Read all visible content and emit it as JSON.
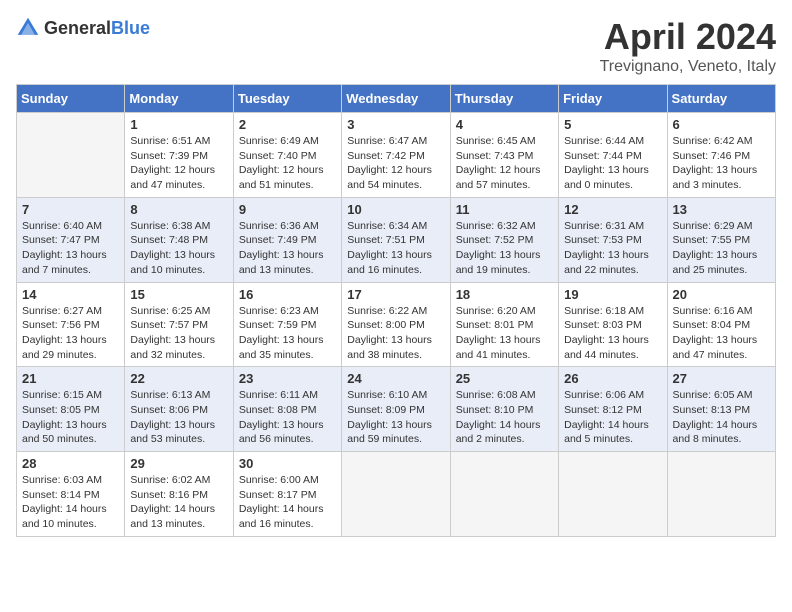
{
  "header": {
    "logo_general": "General",
    "logo_blue": "Blue",
    "title": "April 2024",
    "location": "Trevignano, Veneto, Italy"
  },
  "days_of_week": [
    "Sunday",
    "Monday",
    "Tuesday",
    "Wednesday",
    "Thursday",
    "Friday",
    "Saturday"
  ],
  "weeks": [
    [
      {
        "day": "",
        "sunrise": "",
        "sunset": "",
        "daylight": ""
      },
      {
        "day": "1",
        "sunrise": "Sunrise: 6:51 AM",
        "sunset": "Sunset: 7:39 PM",
        "daylight": "Daylight: 12 hours and 47 minutes."
      },
      {
        "day": "2",
        "sunrise": "Sunrise: 6:49 AM",
        "sunset": "Sunset: 7:40 PM",
        "daylight": "Daylight: 12 hours and 51 minutes."
      },
      {
        "day": "3",
        "sunrise": "Sunrise: 6:47 AM",
        "sunset": "Sunset: 7:42 PM",
        "daylight": "Daylight: 12 hours and 54 minutes."
      },
      {
        "day": "4",
        "sunrise": "Sunrise: 6:45 AM",
        "sunset": "Sunset: 7:43 PM",
        "daylight": "Daylight: 12 hours and 57 minutes."
      },
      {
        "day": "5",
        "sunrise": "Sunrise: 6:44 AM",
        "sunset": "Sunset: 7:44 PM",
        "daylight": "Daylight: 13 hours and 0 minutes."
      },
      {
        "day": "6",
        "sunrise": "Sunrise: 6:42 AM",
        "sunset": "Sunset: 7:46 PM",
        "daylight": "Daylight: 13 hours and 3 minutes."
      }
    ],
    [
      {
        "day": "7",
        "sunrise": "Sunrise: 6:40 AM",
        "sunset": "Sunset: 7:47 PM",
        "daylight": "Daylight: 13 hours and 7 minutes."
      },
      {
        "day": "8",
        "sunrise": "Sunrise: 6:38 AM",
        "sunset": "Sunset: 7:48 PM",
        "daylight": "Daylight: 13 hours and 10 minutes."
      },
      {
        "day": "9",
        "sunrise": "Sunrise: 6:36 AM",
        "sunset": "Sunset: 7:49 PM",
        "daylight": "Daylight: 13 hours and 13 minutes."
      },
      {
        "day": "10",
        "sunrise": "Sunrise: 6:34 AM",
        "sunset": "Sunset: 7:51 PM",
        "daylight": "Daylight: 13 hours and 16 minutes."
      },
      {
        "day": "11",
        "sunrise": "Sunrise: 6:32 AM",
        "sunset": "Sunset: 7:52 PM",
        "daylight": "Daylight: 13 hours and 19 minutes."
      },
      {
        "day": "12",
        "sunrise": "Sunrise: 6:31 AM",
        "sunset": "Sunset: 7:53 PM",
        "daylight": "Daylight: 13 hours and 22 minutes."
      },
      {
        "day": "13",
        "sunrise": "Sunrise: 6:29 AM",
        "sunset": "Sunset: 7:55 PM",
        "daylight": "Daylight: 13 hours and 25 minutes."
      }
    ],
    [
      {
        "day": "14",
        "sunrise": "Sunrise: 6:27 AM",
        "sunset": "Sunset: 7:56 PM",
        "daylight": "Daylight: 13 hours and 29 minutes."
      },
      {
        "day": "15",
        "sunrise": "Sunrise: 6:25 AM",
        "sunset": "Sunset: 7:57 PM",
        "daylight": "Daylight: 13 hours and 32 minutes."
      },
      {
        "day": "16",
        "sunrise": "Sunrise: 6:23 AM",
        "sunset": "Sunset: 7:59 PM",
        "daylight": "Daylight: 13 hours and 35 minutes."
      },
      {
        "day": "17",
        "sunrise": "Sunrise: 6:22 AM",
        "sunset": "Sunset: 8:00 PM",
        "daylight": "Daylight: 13 hours and 38 minutes."
      },
      {
        "day": "18",
        "sunrise": "Sunrise: 6:20 AM",
        "sunset": "Sunset: 8:01 PM",
        "daylight": "Daylight: 13 hours and 41 minutes."
      },
      {
        "day": "19",
        "sunrise": "Sunrise: 6:18 AM",
        "sunset": "Sunset: 8:03 PM",
        "daylight": "Daylight: 13 hours and 44 minutes."
      },
      {
        "day": "20",
        "sunrise": "Sunrise: 6:16 AM",
        "sunset": "Sunset: 8:04 PM",
        "daylight": "Daylight: 13 hours and 47 minutes."
      }
    ],
    [
      {
        "day": "21",
        "sunrise": "Sunrise: 6:15 AM",
        "sunset": "Sunset: 8:05 PM",
        "daylight": "Daylight: 13 hours and 50 minutes."
      },
      {
        "day": "22",
        "sunrise": "Sunrise: 6:13 AM",
        "sunset": "Sunset: 8:06 PM",
        "daylight": "Daylight: 13 hours and 53 minutes."
      },
      {
        "day": "23",
        "sunrise": "Sunrise: 6:11 AM",
        "sunset": "Sunset: 8:08 PM",
        "daylight": "Daylight: 13 hours and 56 minutes."
      },
      {
        "day": "24",
        "sunrise": "Sunrise: 6:10 AM",
        "sunset": "Sunset: 8:09 PM",
        "daylight": "Daylight: 13 hours and 59 minutes."
      },
      {
        "day": "25",
        "sunrise": "Sunrise: 6:08 AM",
        "sunset": "Sunset: 8:10 PM",
        "daylight": "Daylight: 14 hours and 2 minutes."
      },
      {
        "day": "26",
        "sunrise": "Sunrise: 6:06 AM",
        "sunset": "Sunset: 8:12 PM",
        "daylight": "Daylight: 14 hours and 5 minutes."
      },
      {
        "day": "27",
        "sunrise": "Sunrise: 6:05 AM",
        "sunset": "Sunset: 8:13 PM",
        "daylight": "Daylight: 14 hours and 8 minutes."
      }
    ],
    [
      {
        "day": "28",
        "sunrise": "Sunrise: 6:03 AM",
        "sunset": "Sunset: 8:14 PM",
        "daylight": "Daylight: 14 hours and 10 minutes."
      },
      {
        "day": "29",
        "sunrise": "Sunrise: 6:02 AM",
        "sunset": "Sunset: 8:16 PM",
        "daylight": "Daylight: 14 hours and 13 minutes."
      },
      {
        "day": "30",
        "sunrise": "Sunrise: 6:00 AM",
        "sunset": "Sunset: 8:17 PM",
        "daylight": "Daylight: 14 hours and 16 minutes."
      },
      {
        "day": "",
        "sunrise": "",
        "sunset": "",
        "daylight": ""
      },
      {
        "day": "",
        "sunrise": "",
        "sunset": "",
        "daylight": ""
      },
      {
        "day": "",
        "sunrise": "",
        "sunset": "",
        "daylight": ""
      },
      {
        "day": "",
        "sunrise": "",
        "sunset": "",
        "daylight": ""
      }
    ]
  ]
}
